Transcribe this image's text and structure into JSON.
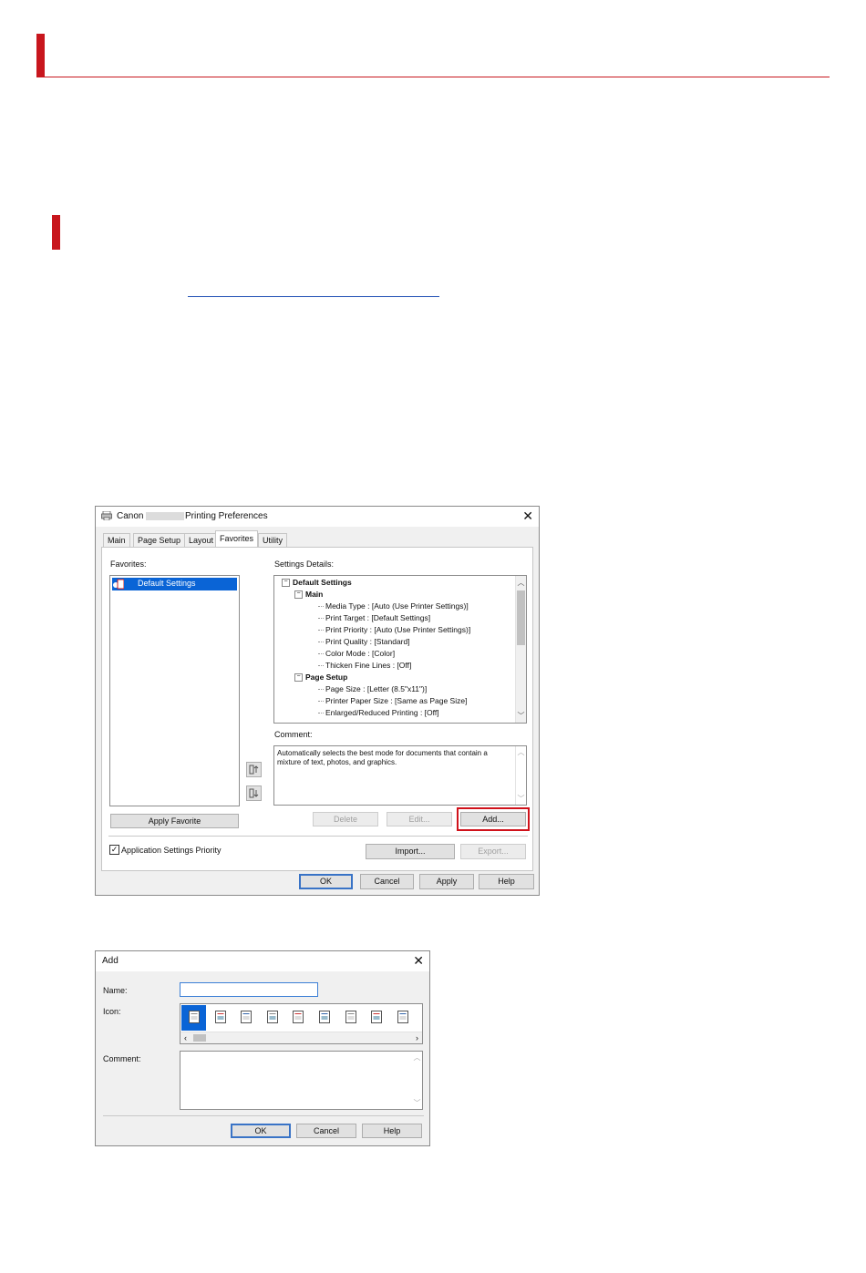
{
  "main_dialog": {
    "title_prefix": "Canon",
    "title_suffix": "Printing Preferences",
    "close_glyph": "✕",
    "tabs": [
      {
        "label": "Main"
      },
      {
        "label": "Page Setup"
      },
      {
        "label": "Layout"
      },
      {
        "label": "Favorites"
      },
      {
        "label": "Utility"
      }
    ],
    "favorites_label": "Favorites:",
    "favorites_items": [
      {
        "label": "Default Settings"
      }
    ],
    "settings_details_label": "Settings Details:",
    "tree": [
      {
        "text": "Default Settings",
        "bold": true,
        "level": 0,
        "expander": "⊟"
      },
      {
        "text": "Main",
        "bold": true,
        "level": 1,
        "expander": "⊟"
      },
      {
        "text": "Media Type : [Auto (Use Printer Settings)]",
        "level": 2
      },
      {
        "text": "Print Target : [Default Settings]",
        "level": 2
      },
      {
        "text": "Print Priority : [Auto (Use Printer Settings)]",
        "level": 2
      },
      {
        "text": "Print Quality : [Standard]",
        "level": 2
      },
      {
        "text": "Color Mode : [Color]",
        "level": 2
      },
      {
        "text": "Thicken Fine Lines : [Off]",
        "level": 2
      },
      {
        "text": "Page Setup",
        "bold": true,
        "level": 1,
        "expander": "⊟"
      },
      {
        "text": "Page Size : [Letter (8.5\"x11\")]",
        "level": 2
      },
      {
        "text": "Printer Paper Size : [Same as Page Size]",
        "level": 2
      },
      {
        "text": "Enlarged/Reduced Printing : [Off]",
        "level": 2
      }
    ],
    "comment_label": "Comment:",
    "comment_text": "Automatically selects the best mode for documents that contain a mixture of text, photos, and graphics.",
    "buttons": {
      "apply_favorite": "Apply Favorite",
      "delete": "Delete",
      "edit": "Edit...",
      "add": "Add...",
      "import": "Import...",
      "export": "Export...",
      "ok": "OK",
      "cancel": "Cancel",
      "apply": "Apply",
      "help": "Help"
    },
    "app_settings_priority": {
      "label": "Application Settings Priority",
      "checked": true
    },
    "highlight_color": "#d0121b"
  },
  "add_dialog": {
    "title": "Add",
    "close_glyph": "✕",
    "name_label": "Name:",
    "name_value": "",
    "icon_label": "Icon:",
    "comment_label": "Comment:",
    "comment_value": "",
    "icons": [
      "doc-icon",
      "text-icon",
      "photo-icon",
      "picture-icon",
      "page-icon",
      "book-icon",
      "edit-icon",
      "chart-icon",
      "notepad-icon"
    ],
    "buttons": {
      "ok": "OK",
      "cancel": "Cancel",
      "help": "Help"
    }
  },
  "accent_red": "#c8161d",
  "link_blue": "#1f4fb4"
}
